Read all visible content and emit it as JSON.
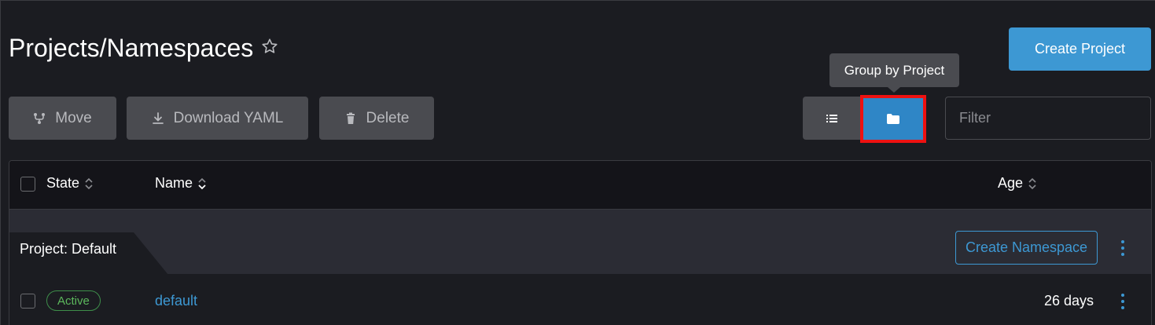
{
  "header": {
    "title": "Projects/Namespaces",
    "create_project_label": "Create Project"
  },
  "tooltip": {
    "text": "Group by Project"
  },
  "toolbar": {
    "move_label": "Move",
    "download_label": "Download YAML",
    "delete_label": "Delete",
    "filter_placeholder": "Filter",
    "filter_value": ""
  },
  "table": {
    "columns": [
      "State",
      "Name",
      "Age"
    ],
    "groups": [
      {
        "label": "Project: Default",
        "create_namespace_label": "Create Namespace",
        "rows": [
          {
            "state": "Active",
            "name": "default",
            "age": "26 days"
          }
        ]
      }
    ]
  },
  "icons": {
    "star": "star-outline-icon",
    "move": "fork-icon",
    "download": "download-icon",
    "delete": "trash-icon",
    "list_view": "list-icon",
    "group_view": "folder-icon"
  },
  "colors": {
    "accent": "#3d98d3",
    "active_green": "#5cb85c",
    "highlight_red": "#ee1111",
    "background": "#1b1c21"
  }
}
